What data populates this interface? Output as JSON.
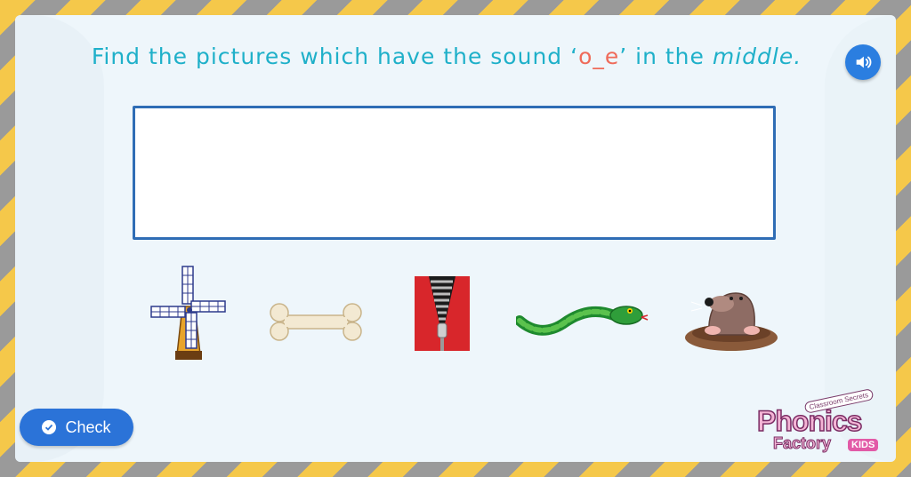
{
  "instruction": {
    "prefix": "Find the pictures which have the sound ‘",
    "sound": "o_e",
    "middle_text": "’ in the ",
    "emphasis": "middle",
    "suffix": "."
  },
  "items": [
    {
      "name": "windmill",
      "icon": "windmill-picture"
    },
    {
      "name": "bone",
      "icon": "bone-picture"
    },
    {
      "name": "zip",
      "icon": "zip-picture"
    },
    {
      "name": "snake",
      "icon": "snake-picture"
    },
    {
      "name": "mole",
      "icon": "mole-picture"
    }
  ],
  "buttons": {
    "check_label": "Check"
  },
  "logo": {
    "small_text": "Classroom Secrets",
    "main_text": "Phonics",
    "sub_text": "Factory",
    "badge_text": "KIDS"
  },
  "colors": {
    "title": "#1fb0c9",
    "sound_highlight": "#ef6b5a",
    "button": "#2b73d8",
    "dropzone_border": "#2f6db5"
  }
}
